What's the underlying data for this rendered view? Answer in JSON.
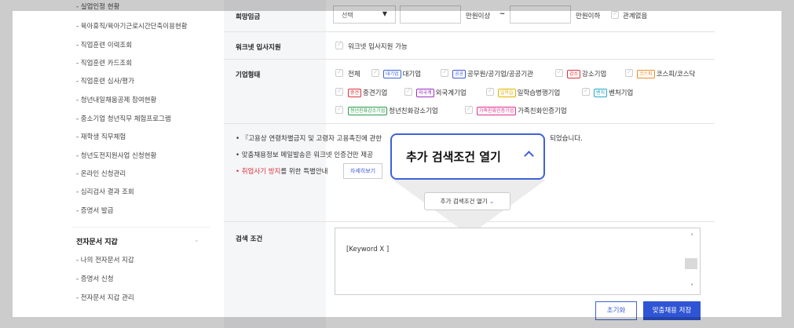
{
  "sidebar": {
    "items": [
      "- 실업인정 현황",
      "- 육아휴직/육아기근로시간단축이용현황",
      "- 직업훈련 이력조회",
      "- 직업훈련 카드조회",
      "- 직업훈련 심사/평가",
      "- 청년내일채움공제 참여현황",
      "- 중소기업 청년직무 체험프로그램",
      "- 재학생 직무체험",
      "- 청년도전지원사업 신청현황",
      "- 온라인 신청관리",
      "- 심리검사 결과 조회",
      "- 증명서 발급"
    ],
    "group_title": "전자문서 지갑",
    "group_items": [
      "- 나의 전자문서 지갑",
      "- 증명서 신청",
      "- 전자문서 지갑 관리"
    ]
  },
  "salary": {
    "label": "희망임금",
    "select_value": "선택",
    "from_unit": "만원이상",
    "tilde": "~",
    "to_unit": "만원이하",
    "any_label": "관계없음"
  },
  "worknet": {
    "label": "워크넷 입사지원",
    "option": "워크넷 입사지원 가능"
  },
  "company": {
    "label": "기업형태",
    "options": [
      {
        "badge": "",
        "text": "전체",
        "color": ""
      },
      {
        "badge": "대기업",
        "text": "대기업",
        "color": "#3f62d6"
      },
      {
        "badge": "공공",
        "text": "공무원/공기업/공공기관",
        "color": "#3b5bd8"
      },
      {
        "badge": "강소",
        "text": "강소기업",
        "color": "#e0303a"
      },
      {
        "badge": "코스피",
        "text": "코스피/코스닥",
        "color": "#f08a24"
      },
      {
        "badge": "중견",
        "text": "중견기업",
        "color": "#e0303a"
      },
      {
        "badge": "외국계",
        "text": "외국계기업",
        "color": "#9b2fc4"
      },
      {
        "badge": "일학습",
        "text": "일학습병행기업",
        "color": "#e0b300"
      },
      {
        "badge": "벤처",
        "text": "벤처기업",
        "color": "#2aa7c9"
      },
      {
        "badge": "청년친화강소기업",
        "text": "청년친화강소기업",
        "color": "#2a9b4a"
      },
      {
        "badge": "가족친화인증기업",
        "text": "가족친화인증기업",
        "color": "#e0308a"
      }
    ]
  },
  "notes": {
    "line1_a": "• 『고용상 연령차별금지 및 고령자 고용촉진에 관한",
    "line1_b": "되었습니다.",
    "line2": "• 맞춤채용정보 메일발송은 워크넷 인증건만 제공",
    "line3_red": "• 취업사기 방지",
    "line3_rest": "를 위한 특별안내",
    "detail_button": "자세히보기"
  },
  "more_button": "추가 검색조건 열기",
  "callout_text": "추가 검색조건 열기",
  "search": {
    "label": "검색 조건",
    "value": "[Keyword X ]"
  },
  "buttons": {
    "reset": "초기화",
    "save": "맞춤채용 저장"
  }
}
